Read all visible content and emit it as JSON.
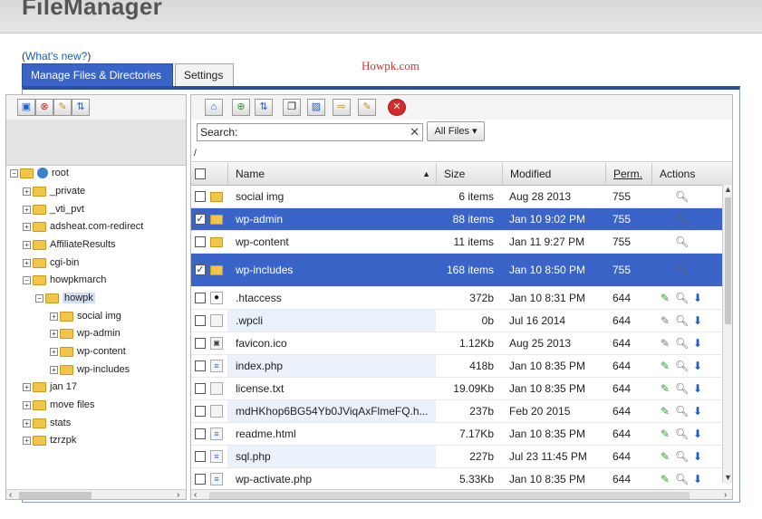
{
  "app": {
    "title": "FileManager",
    "whats_new": "What's new?"
  },
  "watermark": "Howpk.com",
  "tabs": [
    {
      "label": "Manage Files & Directories",
      "active": true
    },
    {
      "label": "Settings",
      "active": false
    }
  ],
  "tree": {
    "root": "root",
    "nodes": [
      "_private",
      "_vti_pvt",
      "adsheat.com-redirect",
      "AffiliateResults",
      "cgi-bin",
      "howpkmarch"
    ],
    "howpkmarch_children": [
      "howpk"
    ],
    "howpk_children": [
      "social img",
      "wp-admin",
      "wp-content",
      "wp-includes"
    ],
    "after": [
      "jan 17",
      "move files",
      "stats",
      "tzrzpk"
    ]
  },
  "search": {
    "label": "Search:",
    "value": ""
  },
  "filter": {
    "label": "All Files",
    "caret": "▾"
  },
  "path": "/",
  "columns": {
    "name": "Name",
    "size": "Size",
    "modified": "Modified",
    "perm": "Perm.",
    "actions": "Actions"
  },
  "files": [
    {
      "name": "social img",
      "size": "6 items",
      "modified": "Aug 28 2013",
      "perm": "755",
      "type": "folder",
      "checked": false,
      "selected": false
    },
    {
      "name": "wp-admin",
      "size": "88 items",
      "modified": "Jan 10 9:02 PM",
      "perm": "755",
      "type": "folder",
      "checked": true,
      "selected": true
    },
    {
      "name": "wp-content",
      "size": "11 items",
      "modified": "Jan 11 9:27 PM",
      "perm": "755",
      "type": "folder",
      "checked": false,
      "selected": false
    },
    {
      "name": "wp-includes",
      "size": "168 items",
      "modified": "Jan 10 8:50 PM",
      "perm": "755",
      "type": "folder",
      "checked": true,
      "selected": true
    },
    {
      "name": ".htaccess",
      "size": "372b",
      "modified": "Jan 10 8:31 PM",
      "perm": "644",
      "type": "dot",
      "checked": false,
      "selected": false
    },
    {
      "name": ".wpcli",
      "size": "0b",
      "modified": "Jul 16 2014",
      "perm": "644",
      "type": "blank",
      "checked": false,
      "selected": false
    },
    {
      "name": "favicon.ico",
      "size": "1.12Kb",
      "modified": "Aug 25 2013",
      "perm": "644",
      "type": "img",
      "checked": false,
      "selected": false
    },
    {
      "name": "index.php",
      "size": "418b",
      "modified": "Jan 10 8:35 PM",
      "perm": "644",
      "type": "php",
      "checked": false,
      "selected": false
    },
    {
      "name": "license.txt",
      "size": "19.09Kb",
      "modified": "Jan 10 8:35 PM",
      "perm": "644",
      "type": "blank",
      "checked": false,
      "selected": false
    },
    {
      "name": "mdHKhop6BG54Yb0JViqAxFlmeFQ.h...",
      "size": "237b",
      "modified": "Feb 20 2015",
      "perm": "644",
      "type": "blank",
      "checked": false,
      "selected": false
    },
    {
      "name": "readme.html",
      "size": "7.17Kb",
      "modified": "Jan 10 8:35 PM",
      "perm": "644",
      "type": "php",
      "checked": false,
      "selected": false
    },
    {
      "name": "sql.php",
      "size": "227b",
      "modified": "Jul 23 11:45 PM",
      "perm": "644",
      "type": "php",
      "checked": false,
      "selected": false
    },
    {
      "name": "wp-activate.php",
      "size": "5.33Kb",
      "modified": "Jan 10 8:35 PM",
      "perm": "644",
      "type": "php",
      "checked": false,
      "selected": false
    }
  ]
}
